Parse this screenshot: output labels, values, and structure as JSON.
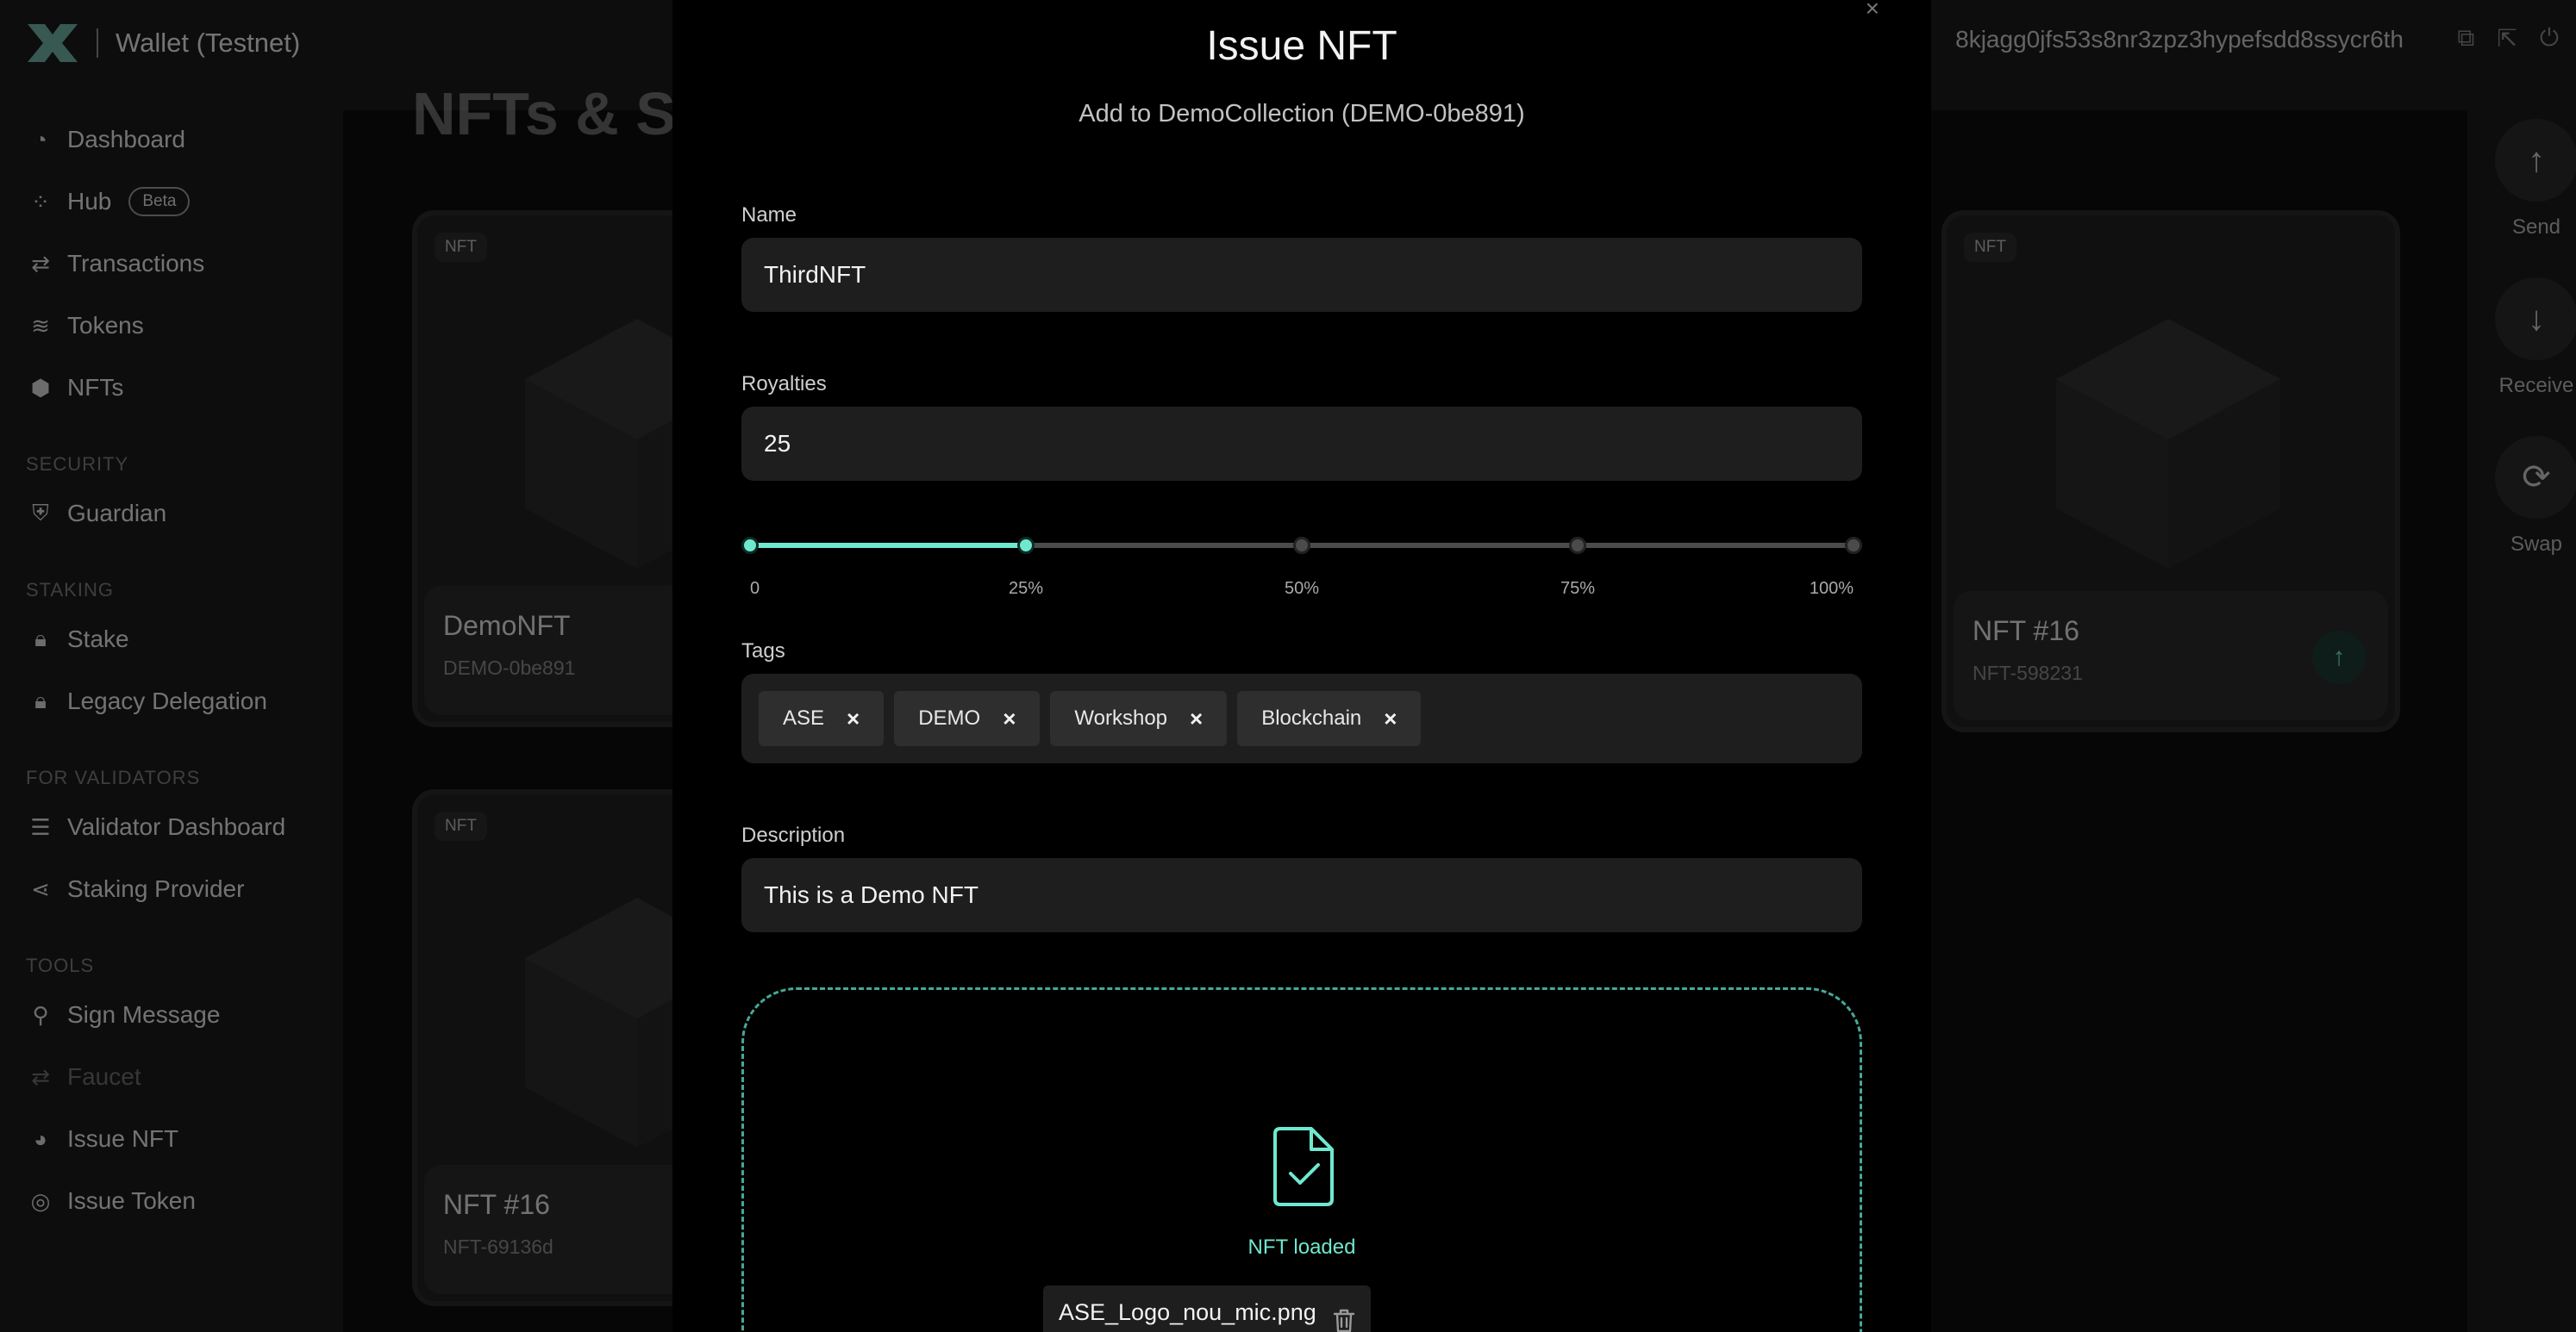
{
  "app": {
    "title": "Wallet (Testnet)",
    "address": "8kjagg0jfs53s8nr3zpz3hypefsdd8ssycr6th",
    "page_title": "NFTs & S"
  },
  "sidebar": {
    "items": [
      {
        "label": "Dashboard",
        "icon": "dashboard-icon"
      },
      {
        "label": "Hub",
        "icon": "hub-icon",
        "badge": "Beta"
      },
      {
        "label": "Transactions",
        "icon": "transactions-icon"
      },
      {
        "label": "Tokens",
        "icon": "tokens-icon"
      },
      {
        "label": "NFTs",
        "icon": "nfts-icon"
      }
    ],
    "sections": {
      "security": "SECURITY",
      "staking": "STAKING",
      "validators": "FOR VALIDATORS",
      "tools": "TOOLS"
    },
    "security_items": [
      {
        "label": "Guardian",
        "icon": "guardian-icon"
      }
    ],
    "staking_items": [
      {
        "label": "Stake",
        "icon": "lock-icon"
      },
      {
        "label": "Legacy Delegation",
        "icon": "lock-icon"
      }
    ],
    "validator_items": [
      {
        "label": "Validator Dashboard",
        "icon": "validator-dashboard-icon"
      },
      {
        "label": "Staking Provider",
        "icon": "share-icon"
      }
    ],
    "tools_items": [
      {
        "label": "Sign Message",
        "icon": "stamp-icon"
      },
      {
        "label": "Faucet",
        "icon": "faucet-icon"
      },
      {
        "label": "Issue NFT",
        "icon": "issue-nft-icon"
      },
      {
        "label": "Issue Token",
        "icon": "issue-token-icon"
      }
    ]
  },
  "cards": [
    {
      "tag": "NFT",
      "name": "DemoNFT",
      "id": "DEMO-0be891"
    },
    {
      "tag": "NFT",
      "name": "NFT #16",
      "id": "NFT-598231"
    },
    {
      "tag": "NFT",
      "name": "NFT #16",
      "id": "NFT-69136d"
    }
  ],
  "right_rail": {
    "send": "Send",
    "receive": "Receive",
    "swap": "Swap"
  },
  "modal": {
    "title": "Issue NFT",
    "subtitle": "Add to DemoCollection (DEMO-0be891)",
    "name_label": "Name",
    "name_value": "ThirdNFT",
    "royalties_label": "Royalties",
    "royalties_value": "25",
    "royalties_percent": 25,
    "slider_ticks": [
      "0",
      "25%",
      "50%",
      "75%",
      "100%"
    ],
    "tags_label": "Tags",
    "tags": [
      "ASE",
      "DEMO",
      "Workshop",
      "Blockchain"
    ],
    "description_label": "Description",
    "description_value": "This is a Demo NFT",
    "upload_status": "NFT loaded",
    "file_name": "ASE_Logo_nou_mic.png"
  },
  "colors": {
    "accent": "#6fe8cf",
    "modal_bg": "#000000",
    "field_bg": "#1e1e1e"
  }
}
